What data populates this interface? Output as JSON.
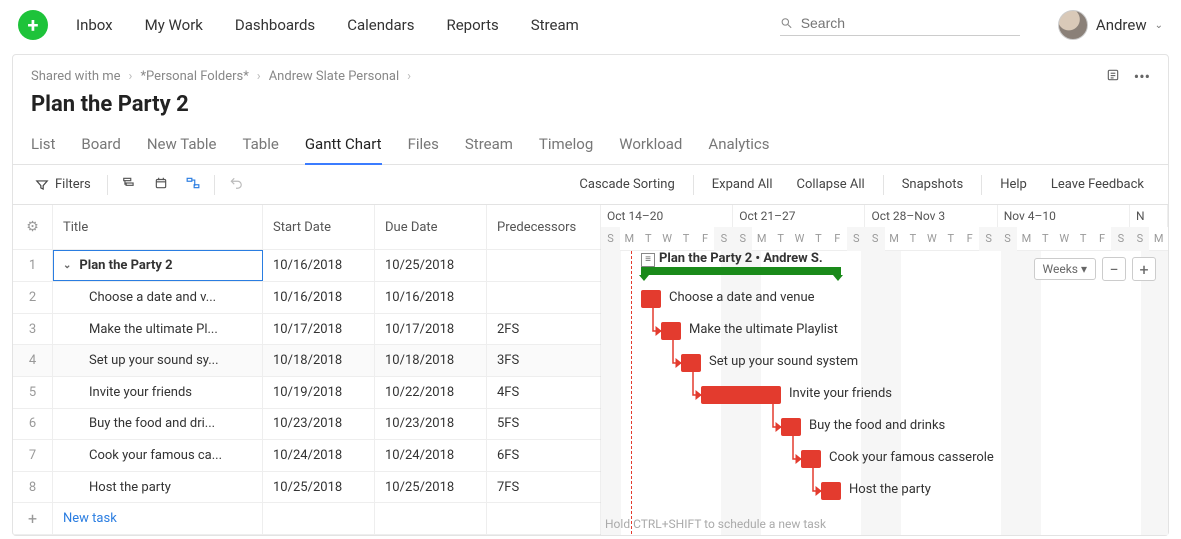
{
  "nav": {
    "items": [
      "Inbox",
      "My Work",
      "Dashboards",
      "Calendars",
      "Reports",
      "Stream"
    ],
    "search_placeholder": "Search",
    "user_name": "Andrew"
  },
  "breadcrumbs": [
    "Shared with me",
    "*Personal Folders*",
    "Andrew Slate Personal"
  ],
  "page_title": "Plan the Party 2",
  "tabs": [
    "List",
    "Board",
    "New Table",
    "Table",
    "Gantt Chart",
    "Files",
    "Stream",
    "Timelog",
    "Workload",
    "Analytics"
  ],
  "active_tab_index": 4,
  "toolbar": {
    "filters": "Filters",
    "right": [
      "Cascade Sorting",
      "Expand All",
      "Collapse All",
      "Snapshots",
      "Help",
      "Leave Feedback"
    ]
  },
  "grid": {
    "columns": [
      "Title",
      "Start Date",
      "Due Date",
      "Predecessors"
    ],
    "rows": [
      {
        "num": "1",
        "title": "Plan the Party 2",
        "start": "10/16/2018",
        "due": "10/25/2018",
        "pred": "",
        "bold": true,
        "selected": true,
        "parent": true
      },
      {
        "num": "2",
        "title": "Choose a date and v...",
        "start": "10/16/2018",
        "due": "10/16/2018",
        "pred": ""
      },
      {
        "num": "3",
        "title": "Make the ultimate Pl...",
        "start": "10/17/2018",
        "due": "10/17/2018",
        "pred": "2FS"
      },
      {
        "num": "4",
        "title": "Set up your sound sy...",
        "start": "10/18/2018",
        "due": "10/18/2018",
        "pred": "3FS"
      },
      {
        "num": "5",
        "title": "Invite your friends",
        "start": "10/19/2018",
        "due": "10/22/2018",
        "pred": "4FS"
      },
      {
        "num": "6",
        "title": "Buy the food and dri...",
        "start": "10/23/2018",
        "due": "10/23/2018",
        "pred": "5FS"
      },
      {
        "num": "7",
        "title": "Cook your famous ca...",
        "start": "10/24/2018",
        "due": "10/24/2018",
        "pred": "6FS"
      },
      {
        "num": "8",
        "title": "Host the party",
        "start": "10/25/2018",
        "due": "10/25/2018",
        "pred": "7FS"
      }
    ],
    "new_task": "New task"
  },
  "timeline": {
    "weeks": [
      "Oct 14–20",
      "Oct 21–27",
      "Oct 28–Nov 3",
      "Nov 4–10",
      "N"
    ],
    "day_letters": [
      "S",
      "M",
      "T",
      "W",
      "T",
      "F",
      "S"
    ],
    "scale_label": "Weeks ▾"
  },
  "gantt": {
    "summary_label": "Plan the Party 2 • Andrew S.",
    "bars": [
      {
        "label": "Choose a date and venue"
      },
      {
        "label": "Make the ultimate Playlist"
      },
      {
        "label": "Set up your sound system"
      },
      {
        "label": "Invite your friends"
      },
      {
        "label": "Buy the food and drinks"
      },
      {
        "label": "Cook your famous casserole"
      },
      {
        "label": "Host the party"
      }
    ],
    "hint": "Hold CTRL+SHIFT to schedule a new task"
  },
  "chart_data": {
    "type": "gantt",
    "title": "Plan the Party 2",
    "owner": "Andrew S.",
    "visible_range": [
      "2018-10-14",
      "2018-11-11"
    ],
    "today": "2018-10-15",
    "summary": {
      "name": "Plan the Party 2",
      "start": "2018-10-16",
      "end": "2018-10-25"
    },
    "tasks": [
      {
        "id": 2,
        "name": "Choose a date and venue",
        "start": "2018-10-16",
        "end": "2018-10-16",
        "predecessors": []
      },
      {
        "id": 3,
        "name": "Make the ultimate Playlist",
        "start": "2018-10-17",
        "end": "2018-10-17",
        "predecessors": [
          {
            "id": 2,
            "type": "FS"
          }
        ]
      },
      {
        "id": 4,
        "name": "Set up your sound system",
        "start": "2018-10-18",
        "end": "2018-10-18",
        "predecessors": [
          {
            "id": 3,
            "type": "FS"
          }
        ]
      },
      {
        "id": 5,
        "name": "Invite your friends",
        "start": "2018-10-19",
        "end": "2018-10-22",
        "predecessors": [
          {
            "id": 4,
            "type": "FS"
          }
        ]
      },
      {
        "id": 6,
        "name": "Buy the food and drinks",
        "start": "2018-10-23",
        "end": "2018-10-23",
        "predecessors": [
          {
            "id": 5,
            "type": "FS"
          }
        ]
      },
      {
        "id": 7,
        "name": "Cook your famous casserole",
        "start": "2018-10-24",
        "end": "2018-10-24",
        "predecessors": [
          {
            "id": 6,
            "type": "FS"
          }
        ]
      },
      {
        "id": 8,
        "name": "Host the party",
        "start": "2018-10-25",
        "end": "2018-10-25",
        "predecessors": [
          {
            "id": 7,
            "type": "FS"
          }
        ]
      }
    ]
  }
}
